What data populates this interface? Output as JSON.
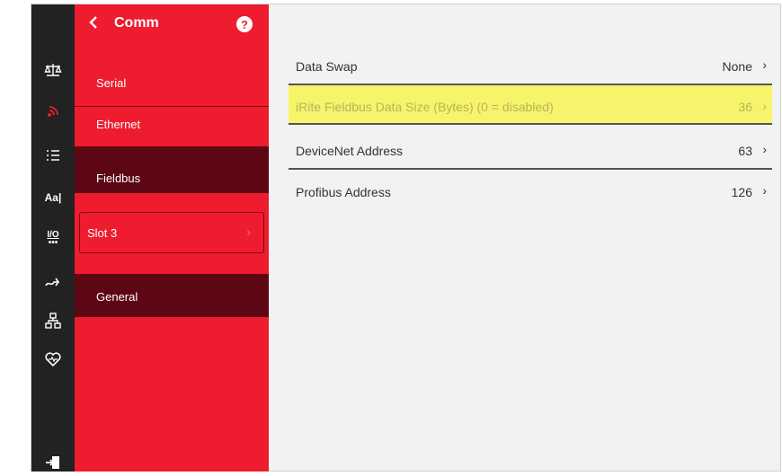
{
  "nav": {
    "title": "Comm",
    "items": [
      {
        "label": "Serial"
      },
      {
        "label": "Ethernet"
      },
      {
        "label": "Fieldbus"
      }
    ],
    "slot": {
      "label": "Slot 3"
    },
    "general": {
      "label": "General"
    }
  },
  "rail": {
    "icons": [
      "scale-icon",
      "wireless-icon",
      "list-icon",
      "text-format-icon",
      "io-icon",
      "route-icon",
      "network-icon",
      "heart-health-icon",
      "logout-icon"
    ],
    "text_icon_label": "Aa|",
    "io_label": "I/O"
  },
  "settings": [
    {
      "label": "Data Swap",
      "value": "None"
    },
    {
      "label": "iRite Fieldbus Data Size (Bytes) (0 = disabled)",
      "value": "36"
    },
    {
      "label": "DeviceNet Address",
      "value": "63"
    },
    {
      "label": "Profibus Address",
      "value": "126"
    }
  ],
  "colors": {
    "nav_red": "#ee1c2e",
    "nav_selected": "#5c0713",
    "rail": "#222222",
    "highlight": "#f6f46a"
  }
}
